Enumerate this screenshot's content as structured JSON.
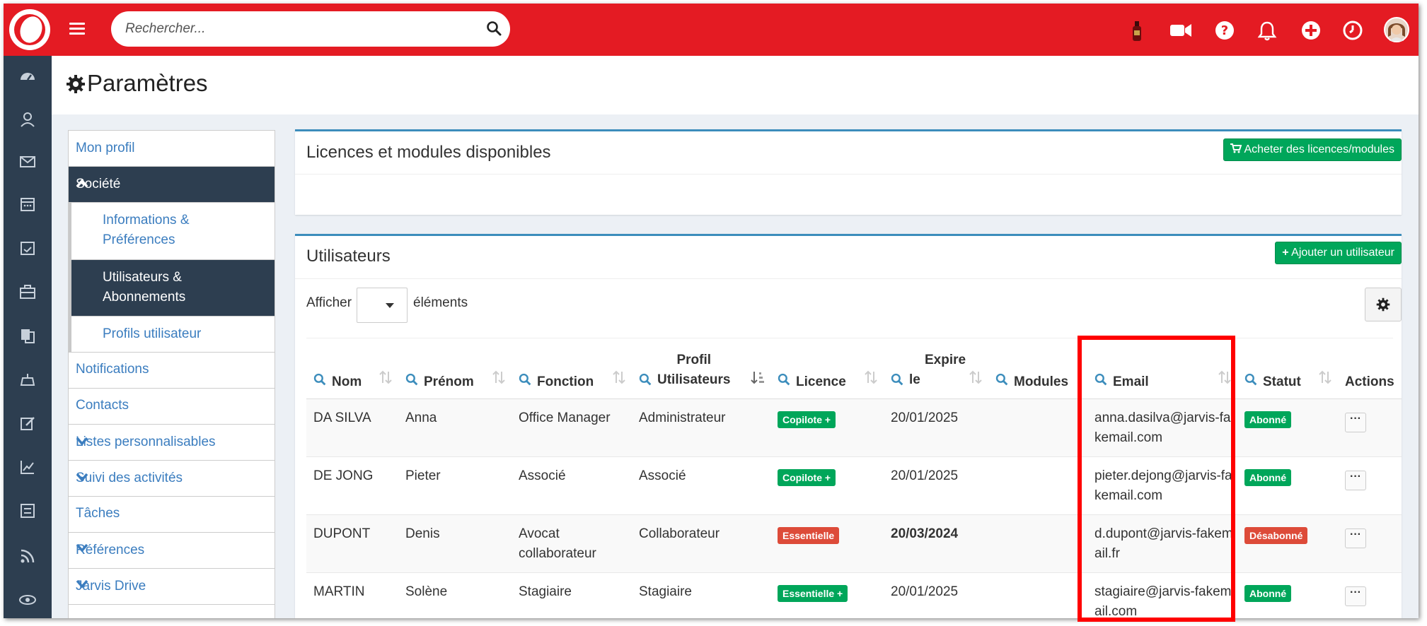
{
  "search": {
    "placeholder": "Rechercher..."
  },
  "colors": {
    "topbar": "#e41b23",
    "rail": "#2d3e50",
    "accent": "#3c8dbc",
    "green": "#00a65a",
    "red": "#dd4b39",
    "highlight": "#ff0000"
  },
  "topbar_icons": [
    "wine-bottle-icon",
    "video-camera-icon",
    "help-icon",
    "bell-icon",
    "plus-circle-icon",
    "clock-icon",
    "user-avatar"
  ],
  "rail_icons": [
    "dashboard-icon",
    "contacts-icon",
    "mail-icon",
    "calendar-icon",
    "calendar-check-icon",
    "briefcase-icon",
    "documents-icon",
    "timer-icon",
    "edit-icon",
    "chart-icon",
    "list-icon",
    "rss-icon",
    "globe-icon"
  ],
  "page": {
    "title": "Paramètres"
  },
  "menu": {
    "mon_profil": "Mon profil",
    "societe": "Société",
    "informations": "Informations & Préférences",
    "utilisateurs": "Utilisateurs & Abonnements",
    "profils": "Profils utilisateur",
    "notifications": "Notifications",
    "contacts": "Contacts",
    "listes": "Listes personnalisables",
    "suivi": "Suivi des activités",
    "taches": "Tâches",
    "references": "Références",
    "drive": "Jarvis Drive"
  },
  "licences": {
    "title": "Licences et modules disponibles",
    "buy_button": "Acheter des licences/modules"
  },
  "users": {
    "title": "Utilisateurs",
    "add_button": "Ajouter un utilisateur",
    "show_label": "Afficher",
    "elements_label": "éléments",
    "columns": {
      "nom": "Nom",
      "prenom": "Prénom",
      "fonction": "Fonction",
      "profil_line1": "Profil",
      "profil_line2": "Utilisateurs",
      "licence": "Licence",
      "expire_line1": "Expire",
      "expire_line2": "le",
      "modules": "Modules",
      "email": "Email",
      "statut": "Statut",
      "actions": "Actions"
    },
    "rows": [
      {
        "nom": "DA SILVA",
        "prenom": "Anna",
        "fonction": "Office Manager",
        "profil": "Administrateur",
        "licence": "Copilote +",
        "expire": "20/01/2025",
        "modules": "",
        "email": "anna.dasilva@jarvis-fakemail.com",
        "statut": "Abonné"
      },
      {
        "nom": "DE JONG",
        "prenom": "Pieter",
        "fonction": "Associé",
        "profil": "Associé",
        "licence": "Copilote +",
        "expire": "20/01/2025",
        "modules": "",
        "email": "pieter.dejong@jarvis-fakemail.com",
        "statut": "Abonné"
      },
      {
        "nom": "DUPONT",
        "prenom": "Denis",
        "fonction": "Avocat collaborateur",
        "profil": "Collaborateur",
        "licence": "Essentielle",
        "expire": "20/03/2024",
        "modules": "",
        "email": "d.dupont@jarvis-fakemail.fr",
        "statut": "Désabonné"
      },
      {
        "nom": "MARTIN",
        "prenom": "Solène",
        "fonction": "Stagiaire",
        "profil": "Stagiaire",
        "licence": "Essentielle +",
        "expire": "20/01/2025",
        "modules": "",
        "email": "stagiaire@jarvis-fakemail.com",
        "statut": "Abonné"
      }
    ]
  }
}
